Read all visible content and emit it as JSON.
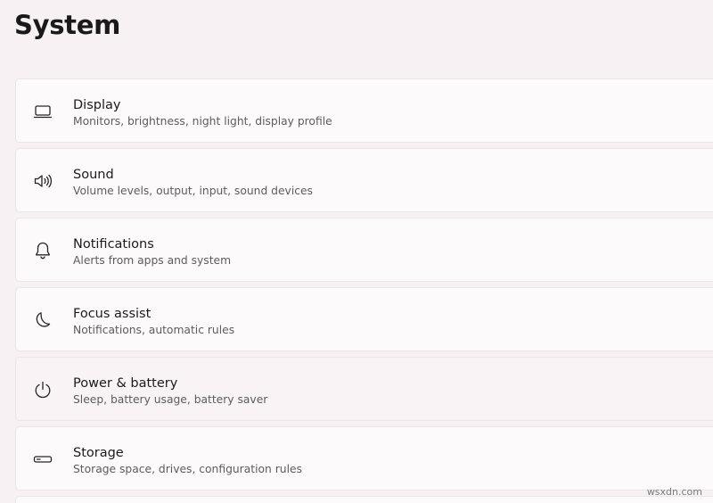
{
  "page": {
    "title": "System"
  },
  "settings": {
    "items": [
      {
        "title": "Display",
        "subtitle": "Monitors, brightness, night light, display profile",
        "icon": "display-icon"
      },
      {
        "title": "Sound",
        "subtitle": "Volume levels, output, input, sound devices",
        "icon": "speaker-icon"
      },
      {
        "title": "Notifications",
        "subtitle": "Alerts from apps and system",
        "icon": "bell-icon"
      },
      {
        "title": "Focus assist",
        "subtitle": "Notifications, automatic rules",
        "icon": "moon-icon"
      },
      {
        "title": "Power & battery",
        "subtitle": "Sleep, battery usage, battery saver",
        "icon": "power-icon"
      },
      {
        "title": "Storage",
        "subtitle": "Storage space, drives, configuration rules",
        "icon": "storage-icon"
      }
    ]
  },
  "watermark": {
    "text": "wsxdn.com"
  },
  "colors": {
    "background": "#f7f1f3",
    "card": "#fdfafb",
    "card_hover": "#f9f3f5",
    "border": "#ebe5e7",
    "title_text": "#1b1b1b",
    "subtitle_text": "#5c5c5c"
  }
}
